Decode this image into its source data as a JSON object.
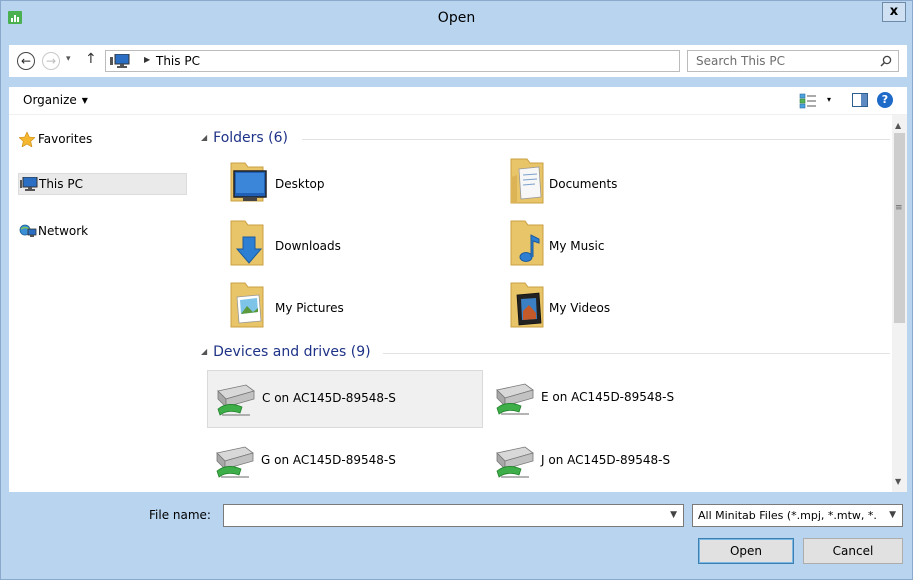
{
  "window": {
    "title": "Open",
    "close_label": "x"
  },
  "nav": {
    "back_label": "←",
    "forward_label": "→",
    "recent_label": "▾",
    "up_label": "↑",
    "address": "This PC",
    "address_dropdown": "⌄",
    "refresh_label": "↻",
    "search_placeholder": "Search This PC"
  },
  "command_bar": {
    "organize_label": "Organize",
    "view_caret": "▾",
    "help_label": "?"
  },
  "sidebar": {
    "items": [
      {
        "label": "Favorites"
      },
      {
        "label": "This PC"
      },
      {
        "label": "Network"
      }
    ]
  },
  "folders_group": {
    "header": "Folders (6)",
    "items": [
      {
        "name": "Desktop"
      },
      {
        "name": "Documents"
      },
      {
        "name": "Downloads"
      },
      {
        "name": "My Music"
      },
      {
        "name": "My Pictures"
      },
      {
        "name": "My Videos"
      }
    ]
  },
  "drives_group": {
    "header": "Devices and drives (9)",
    "items": [
      {
        "name": "C on AC145D-89548-S"
      },
      {
        "name": "E on AC145D-89548-S"
      },
      {
        "name": "G on AC145D-89548-S"
      },
      {
        "name": "J on AC145D-89548-S"
      }
    ]
  },
  "footer": {
    "file_name_label": "File name:",
    "file_name_value": "",
    "file_type_selected": "All Minitab Files (*.mpj, *.mtw, *.",
    "open_label": "Open",
    "cancel_label": "Cancel"
  },
  "colors": {
    "accent": "#1e3287",
    "window_frame": "#b8d4ef",
    "selection": "#f0f0f0"
  }
}
